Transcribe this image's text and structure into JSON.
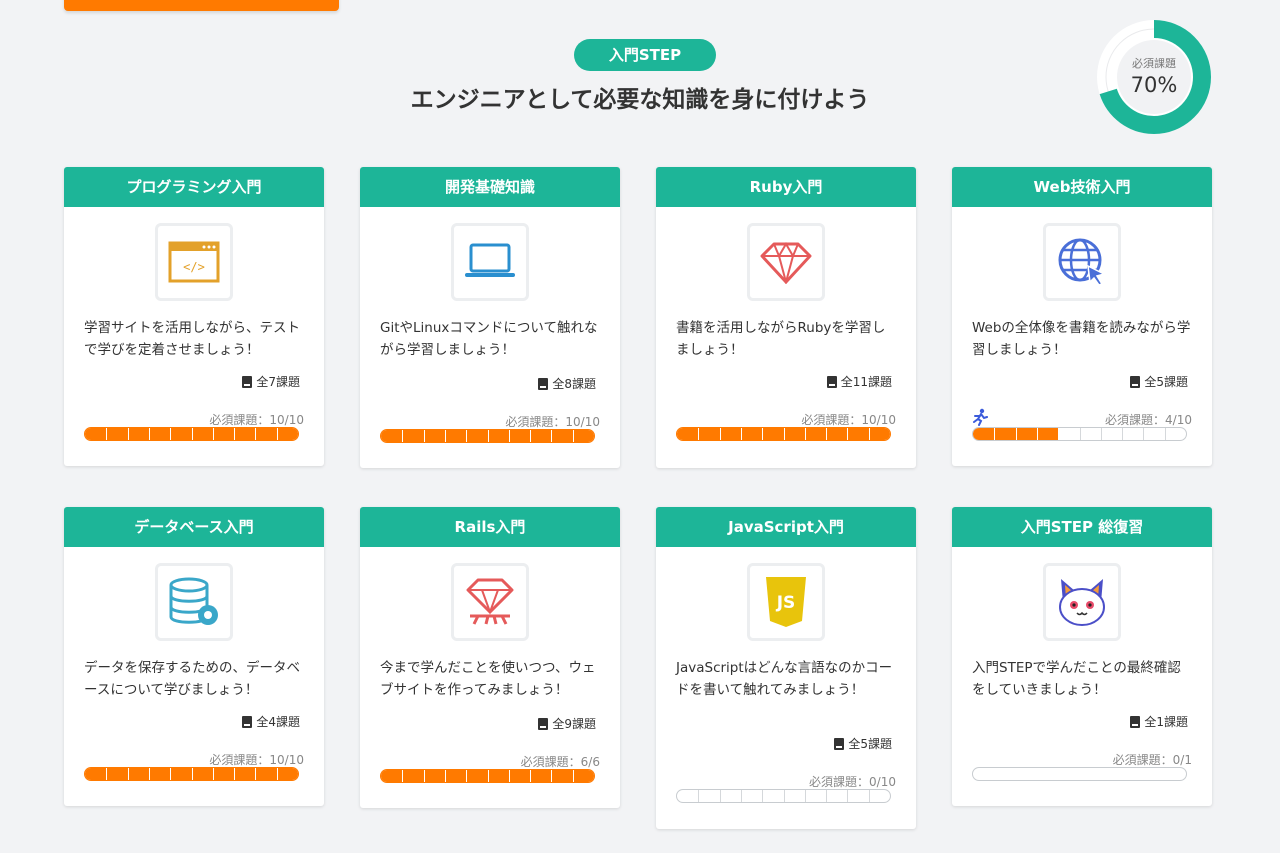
{
  "header": {
    "badge": "入門STEP",
    "title": "エンジニアとして必要な知識を身に付けよう",
    "donut_label": "必須課題",
    "donut_value": "70%",
    "donut_percent": 70,
    "accent_color": "#1db598",
    "progress_color": "#ff7a00"
  },
  "cards": [
    {
      "title": "プログラミング入門",
      "icon": "code-window-icon",
      "desc": "学習サイトを活用しながら、テストで学びを定着させましょう！",
      "count": "全7課題",
      "req": "必須課題：10/10",
      "done": 10,
      "total": 10
    },
    {
      "title": "開発基礎知識",
      "icon": "laptop-icon",
      "desc": "GitやLinuxコマンドについて触れながら学習しましょう！",
      "count": "全8課題",
      "req": "必須課題：10/10",
      "done": 10,
      "total": 10
    },
    {
      "title": "Ruby入門",
      "icon": "ruby-gem-icon",
      "desc": "書籍を活用しながらRubyを学習しましょう！",
      "count": "全11課題",
      "req": "必須課題：10/10",
      "done": 10,
      "total": 10
    },
    {
      "title": "Web技術入門",
      "icon": "globe-cursor-icon",
      "desc": "Webの全体像を書籍を読みながら学習しましょう！",
      "count": "全5課題",
      "req": "必須課題：4/10",
      "done": 4,
      "total": 10,
      "runner": "running-person-icon"
    },
    {
      "title": "データベース入門",
      "icon": "database-gear-icon",
      "desc": "データを保存するための、データベースについて学びましょう！",
      "count": "全4課題",
      "req": "必須課題：10/10",
      "done": 10,
      "total": 10
    },
    {
      "title": "Rails入門",
      "icon": "rails-gem-icon",
      "desc": "今まで学んだことを使いつつ、ウェブサイトを作ってみましょう！",
      "count": "全9課題",
      "req": "必須課題：6/6",
      "done": 6,
      "total": 6
    },
    {
      "title": "JavaScript入門",
      "icon": "javascript-shield-icon",
      "desc": "JavaScriptはどんな言語なのかコードを書いて触れてみましょう！",
      "count": "全5課題",
      "req": "必須課題：0/10",
      "done": 0,
      "total": 10
    },
    {
      "title": "入門STEP 総復習",
      "icon": "cat-mascot-icon",
      "desc": "入門STEPで学んだことの最終確認をしていきましょう！",
      "count": "全1課題",
      "req": "必須課題：0/1",
      "done": 0,
      "total": 1
    }
  ]
}
